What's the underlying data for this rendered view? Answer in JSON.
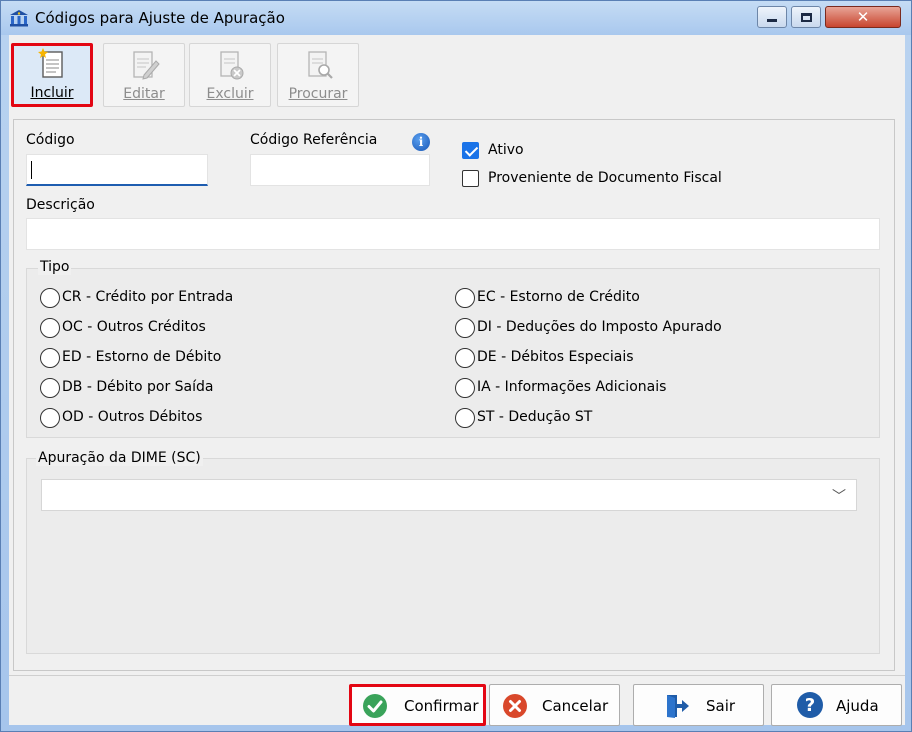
{
  "window": {
    "title": "Códigos para Ajuste de Apuração",
    "close_glyph": "✕"
  },
  "toolbar": {
    "buttons": [
      {
        "label": "Incluir",
        "icon": "new-document-icon",
        "enabled": true,
        "active": true
      },
      {
        "label": "Editar",
        "icon": "edit-document-icon",
        "enabled": false
      },
      {
        "label": "Excluir",
        "icon": "delete-document-icon",
        "enabled": false
      },
      {
        "label": "Procurar",
        "icon": "search-document-icon",
        "enabled": false
      }
    ]
  },
  "form": {
    "codigo_label": "Código",
    "codigo_value": "",
    "codigo_ref_label": "Código Referência",
    "codigo_ref_value": "",
    "info_glyph": "i",
    "ativo_label": "Ativo",
    "ativo_checked": true,
    "proveniente_label": "Proveniente de Documento Fiscal",
    "proveniente_checked": false,
    "descricao_label": "Descrição",
    "descricao_value": "",
    "tipo": {
      "title": "Tipo",
      "left": [
        "CR - Crédito por Entrada",
        "OC - Outros Créditos",
        "ED - Estorno de Débito",
        "DB - Débito por Saída",
        "OD - Outros Débitos"
      ],
      "right": [
        "EC - Estorno de Crédito",
        "DI - Deduções do Imposto Apurado",
        "DE - Débitos Especiais",
        "IA - Informações Adicionais",
        "ST - Dedução ST"
      ]
    },
    "dime": {
      "title": "Apuração da DIME (SC)",
      "selected": "",
      "chevron": "﹀"
    }
  },
  "footer": {
    "confirmar": "Confirmar",
    "cancelar": "Cancelar",
    "sair": "Sair",
    "ajuda": "Ajuda"
  },
  "colors": {
    "highlight": "#e30613",
    "accent": "#1a73e8"
  }
}
